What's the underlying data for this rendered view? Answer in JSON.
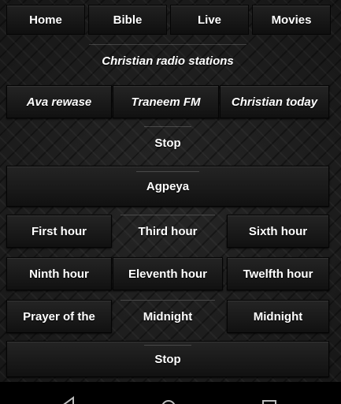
{
  "tabs": {
    "home": "Home",
    "bible": "Bible",
    "live": "Live",
    "movies": "Movies"
  },
  "section": {
    "christian_radio": "Christian radio stations"
  },
  "radio": {
    "ava_rewase": "Ava rewase",
    "traneem_fm": "Traneem FM",
    "christian_today": "Christian today"
  },
  "stop1": "Stop",
  "agpeya": {
    "title": "Agpeya"
  },
  "hours": {
    "first": "First hour",
    "third": "Third hour",
    "sixth": "Sixth hour",
    "ninth": "Ninth hour",
    "eleventh": "Eleventh hour",
    "twelfth": "Twelfth hour",
    "prayer_of_the": "Prayer of the",
    "midnight_1": "Midnight",
    "midnight_2": "Midnight"
  },
  "stop2": "Stop",
  "nav_icons": [
    "back-icon",
    "home-icon",
    "recents-icon"
  ]
}
